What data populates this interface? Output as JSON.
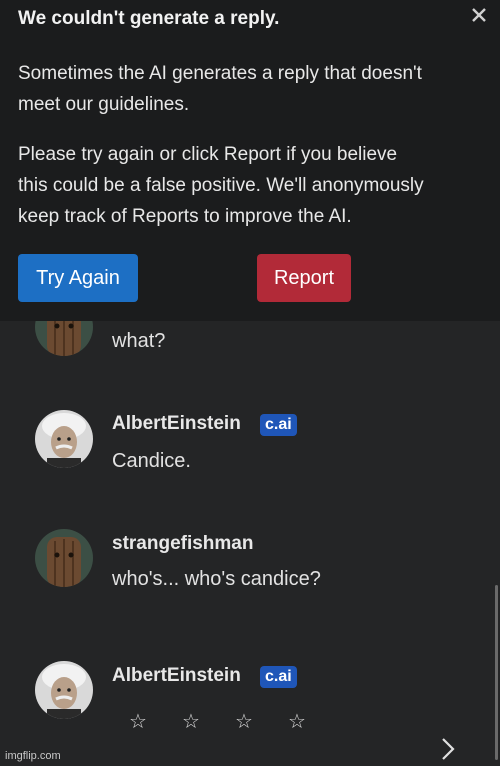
{
  "dialog": {
    "title": "We couldn't generate a reply.",
    "p1_line1": "Sometimes the AI generates a reply that doesn't",
    "p1_line2": "meet our guidelines.",
    "p2_line1": "Please try again or click Report if you believe",
    "p2_line2": "this could be a false positive. We'll anonymously",
    "p2_line3": "keep track of Reports to improve the AI.",
    "try_again_label": "Try Again",
    "report_label": "Report",
    "colors": {
      "primary": "#1d6fc4",
      "danger": "#b22a38"
    }
  },
  "messages": [
    {
      "author": "",
      "badge": "",
      "text": "what?"
    },
    {
      "author": "AlbertEinstein",
      "badge": "c.ai",
      "text": "Candice."
    },
    {
      "author": "strangefishman",
      "badge": "",
      "text": "who's... who's candice?"
    },
    {
      "author": "AlbertEinstein",
      "badge": "c.ai",
      "text": ""
    }
  ],
  "rating": {
    "stars": [
      "☆",
      "☆",
      "☆",
      "☆"
    ]
  },
  "watermark": "imgflip.com",
  "icons": {
    "close": "close-icon",
    "next": "chevron-right-icon"
  }
}
